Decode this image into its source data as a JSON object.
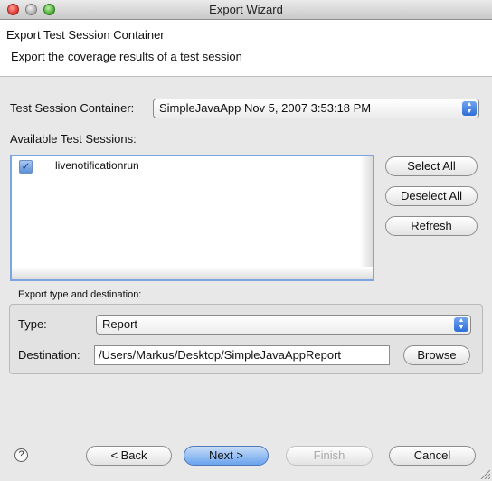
{
  "window": {
    "title": "Export Wizard"
  },
  "header": {
    "title": "Export Test Session Container",
    "description": "Export the coverage results of a test session"
  },
  "container": {
    "label": "Test Session Container:",
    "selected": "SimpleJavaApp Nov 5, 2007 3:53:18 PM"
  },
  "sessions": {
    "label": "Available Test Sessions:",
    "items": [
      {
        "label": "livenotificationrun",
        "checked": true
      }
    ]
  },
  "side_buttons": {
    "select_all": "Select All",
    "deselect_all": "Deselect All",
    "refresh": "Refresh"
  },
  "export": {
    "group_title": "Export type and destination:",
    "type_label": "Type:",
    "type_value": "Report",
    "destination_label": "Destination:",
    "destination_value": "/Users/Markus/Desktop/SimpleJavaAppReport",
    "browse": "Browse"
  },
  "footer": {
    "help": "?",
    "back": "< Back",
    "next": "Next >",
    "finish": "Finish",
    "cancel": "Cancel"
  },
  "icons": {
    "close": "close-button-icon",
    "minimize": "minimize-button-icon",
    "zoom": "zoom-button-icon",
    "checkbox": "checkbox-checked-icon",
    "stepper": "popup-stepper-icon",
    "help": "help-icon"
  },
  "colors": {
    "accent": "#6aa3ee",
    "header_bg": "#ffffff",
    "window_bg": "#e8e8e8"
  }
}
